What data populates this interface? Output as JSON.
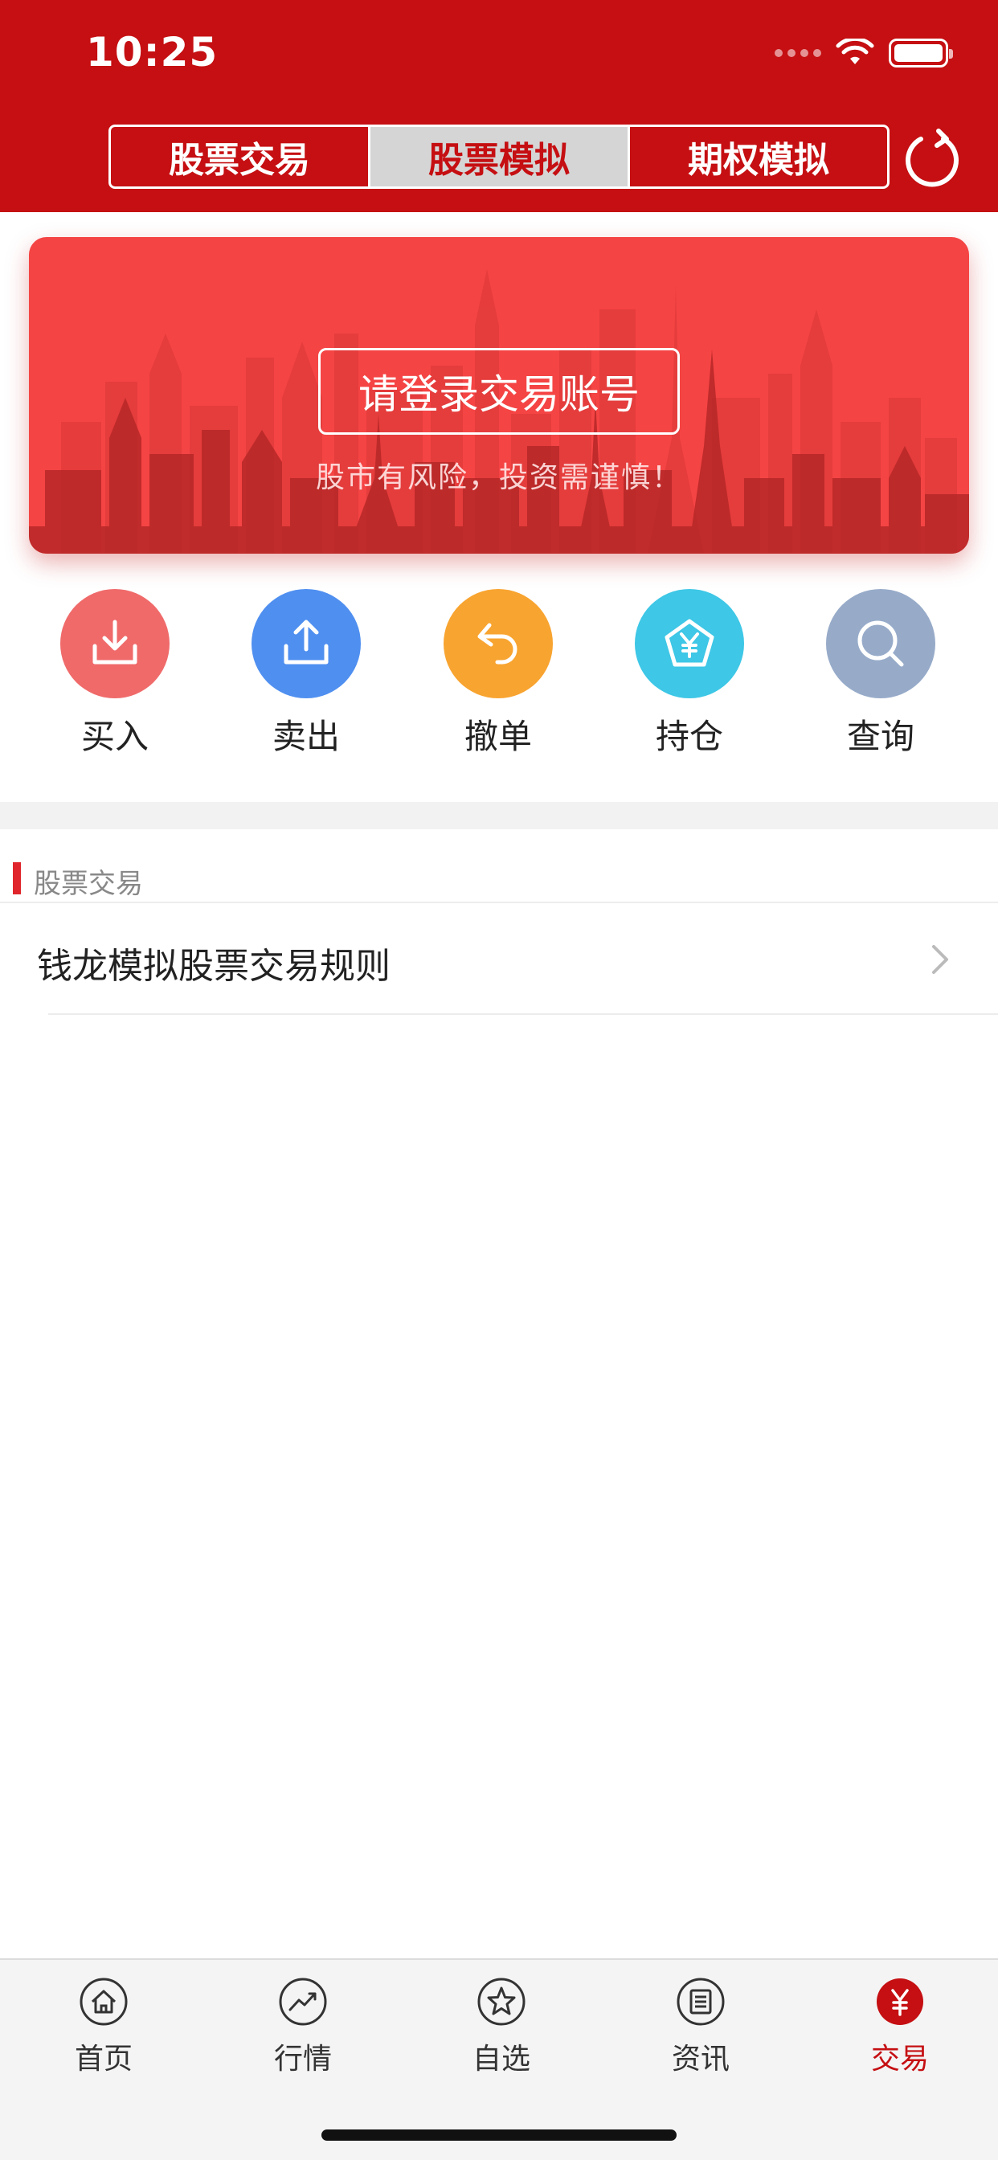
{
  "status": {
    "time": "10:25"
  },
  "header": {
    "tabs": [
      {
        "label": "股票交易",
        "active": false
      },
      {
        "label": "股票模拟",
        "active": true
      },
      {
        "label": "期权模拟",
        "active": false
      }
    ],
    "refresh_icon": "refresh-icon",
    "color": "#c50f12"
  },
  "banner": {
    "login_label": "请登录交易账号",
    "risk_text": "股市有风险，投资需谨慎！",
    "color": "#f54444"
  },
  "actions": [
    {
      "label": "买入",
      "icon": "download-icon",
      "color": "#f06a6a"
    },
    {
      "label": "卖出",
      "icon": "upload-icon",
      "color": "#4f8ff0"
    },
    {
      "label": "撤单",
      "icon": "undo-icon",
      "color": "#f8a430"
    },
    {
      "label": "持仓",
      "icon": "yen-shield-icon",
      "color": "#3ec7e6"
    },
    {
      "label": "查询",
      "icon": "search-icon",
      "color": "#97abc9"
    }
  ],
  "section": {
    "title": "股票交易",
    "items": [
      {
        "label": "钱龙模拟股票交易规则"
      }
    ]
  },
  "tabbar": {
    "items": [
      {
        "label": "首页",
        "icon": "home-icon",
        "active": false
      },
      {
        "label": "行情",
        "icon": "trend-chart-icon",
        "active": false
      },
      {
        "label": "自选",
        "icon": "star-icon",
        "active": false
      },
      {
        "label": "资讯",
        "icon": "news-icon",
        "active": false
      },
      {
        "label": "交易",
        "icon": "yen-icon",
        "active": true
      }
    ],
    "active_color": "#c50f12"
  }
}
